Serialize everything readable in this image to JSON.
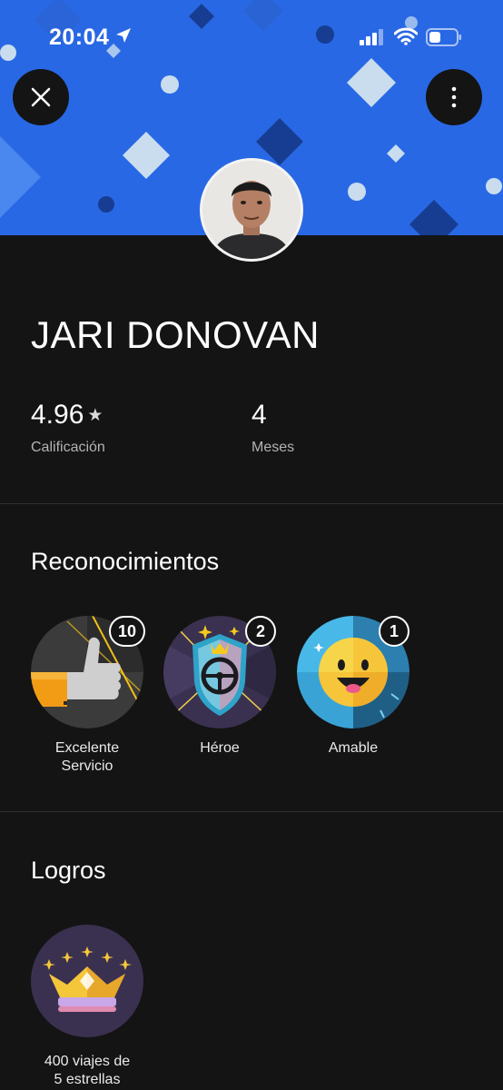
{
  "status_bar": {
    "time": "20:04"
  },
  "header": {
    "close_icon": "close-icon",
    "more_icon": "vertical-ellipsis-icon"
  },
  "driver": {
    "name": "JARI DONOVAN",
    "rating": "4.96",
    "rating_label": "Calificación",
    "months": "4",
    "months_label": "Meses"
  },
  "recognitions": {
    "title": "Reconocimientos",
    "items": [
      {
        "label_line1": "Excelente",
        "label_line2": "Servicio",
        "count": "10"
      },
      {
        "label_line1": "Héroe",
        "label_line2": "",
        "count": "2"
      },
      {
        "label_line1": "Amable",
        "label_line2": "",
        "count": "1"
      }
    ]
  },
  "achievements": {
    "title": "Logros",
    "items": [
      {
        "label_line1": "400 viajes de",
        "label_line2": "5 estrellas"
      }
    ]
  },
  "colors": {
    "header_blue": "#2f6ee6",
    "background": "#141414"
  }
}
